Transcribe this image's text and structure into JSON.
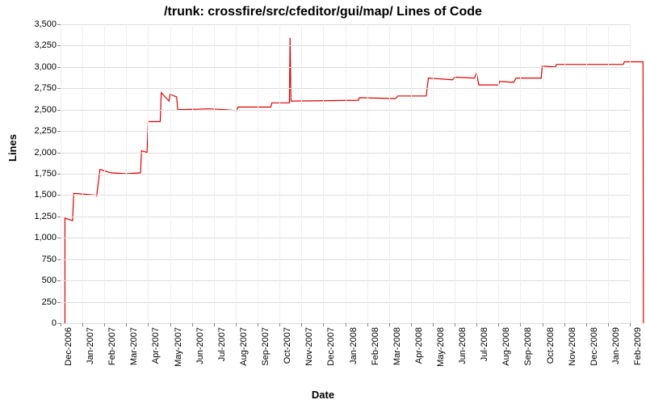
{
  "chart_data": {
    "type": "line",
    "title": "/trunk: crossfire/src/cfeditor/gui/map/ Lines of Code",
    "xlabel": "Date",
    "ylabel": "Lines",
    "ylim": [
      0,
      3500
    ],
    "yticks": [
      0,
      250,
      500,
      750,
      1000,
      1250,
      1500,
      1750,
      2000,
      2250,
      2500,
      2750,
      3000,
      3250,
      3500
    ],
    "ytick_labels": [
      "0",
      "250",
      "500",
      "750",
      "1,000",
      "1,250",
      "1,500",
      "1,750",
      "2,000",
      "2,250",
      "2,500",
      "2,750",
      "3,000",
      "3,250",
      "3,500"
    ],
    "xticks": [
      "Dec-2006",
      "Jan-2007",
      "Feb-2007",
      "Mar-2007",
      "Apr-2007",
      "May-2007",
      "Jun-2007",
      "Jul-2007",
      "Aug-2007",
      "Sep-2007",
      "Oct-2007",
      "Nov-2007",
      "Dec-2007",
      "Jan-2008",
      "Feb-2008",
      "Mar-2008",
      "Apr-2008",
      "May-2008",
      "Jun-2008",
      "Jul-2008",
      "Aug-2008",
      "Sep-2008",
      "Oct-2008",
      "Nov-2008",
      "Dec-2008",
      "Jan-2009",
      "Feb-2009"
    ],
    "series": [
      {
        "name": "Lines of Code",
        "color": "#e00000",
        "points": [
          {
            "x": 0.2,
            "y": 0
          },
          {
            "x": 0.2,
            "y": 1230
          },
          {
            "x": 0.55,
            "y": 1200
          },
          {
            "x": 0.6,
            "y": 1520
          },
          {
            "x": 1.6,
            "y": 1500
          },
          {
            "x": 1.65,
            "y": 1490
          },
          {
            "x": 1.8,
            "y": 1800
          },
          {
            "x": 2.3,
            "y": 1760
          },
          {
            "x": 3.0,
            "y": 1750
          },
          {
            "x": 3.65,
            "y": 1760
          },
          {
            "x": 3.7,
            "y": 2020
          },
          {
            "x": 3.95,
            "y": 2000
          },
          {
            "x": 4.0,
            "y": 2360
          },
          {
            "x": 4.55,
            "y": 2360
          },
          {
            "x": 4.6,
            "y": 2700
          },
          {
            "x": 4.95,
            "y": 2600
          },
          {
            "x": 5.0,
            "y": 2680
          },
          {
            "x": 5.3,
            "y": 2650
          },
          {
            "x": 5.35,
            "y": 2500
          },
          {
            "x": 6.8,
            "y": 2510
          },
          {
            "x": 7.5,
            "y": 2500
          },
          {
            "x": 8.05,
            "y": 2490
          },
          {
            "x": 8.1,
            "y": 2530
          },
          {
            "x": 9.6,
            "y": 2530
          },
          {
            "x": 9.65,
            "y": 2580
          },
          {
            "x": 10.45,
            "y": 2580
          },
          {
            "x": 10.48,
            "y": 3340
          },
          {
            "x": 10.52,
            "y": 2600
          },
          {
            "x": 13.6,
            "y": 2610
          },
          {
            "x": 13.65,
            "y": 2640
          },
          {
            "x": 15.3,
            "y": 2630
          },
          {
            "x": 15.4,
            "y": 2660
          },
          {
            "x": 16.7,
            "y": 2660
          },
          {
            "x": 16.8,
            "y": 2870
          },
          {
            "x": 17.9,
            "y": 2850
          },
          {
            "x": 18.0,
            "y": 2880
          },
          {
            "x": 18.9,
            "y": 2870
          },
          {
            "x": 19.0,
            "y": 2930
          },
          {
            "x": 19.1,
            "y": 2790
          },
          {
            "x": 20.0,
            "y": 2790
          },
          {
            "x": 20.05,
            "y": 2830
          },
          {
            "x": 20.7,
            "y": 2820
          },
          {
            "x": 20.8,
            "y": 2870
          },
          {
            "x": 21.95,
            "y": 2870
          },
          {
            "x": 22.0,
            "y": 3010
          },
          {
            "x": 22.6,
            "y": 3000
          },
          {
            "x": 22.65,
            "y": 3030
          },
          {
            "x": 25.7,
            "y": 3030
          },
          {
            "x": 25.75,
            "y": 3060
          },
          {
            "x": 26.6,
            "y": 3060
          },
          {
            "x": 26.62,
            "y": 0
          }
        ]
      }
    ]
  }
}
